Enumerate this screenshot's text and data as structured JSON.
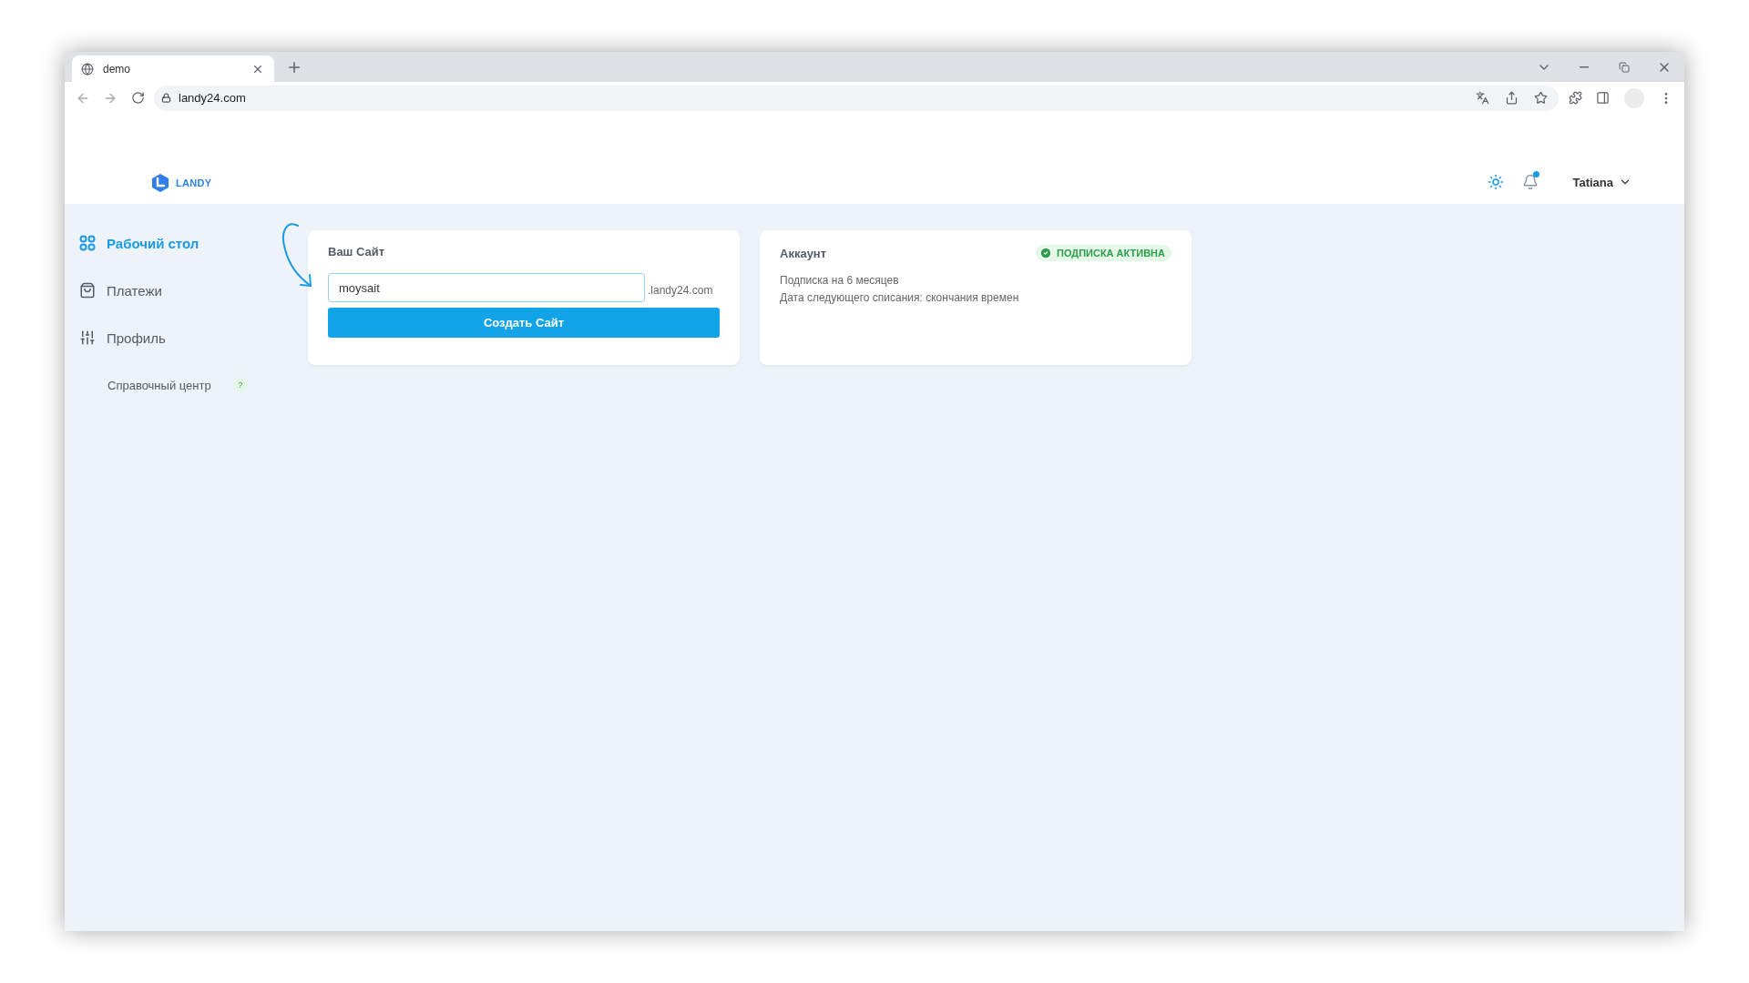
{
  "browser": {
    "tab": {
      "title": "demo"
    },
    "address": "landy24.com"
  },
  "app": {
    "logo": "LANDY",
    "user": "Tatiana",
    "notifications": {
      "unread": true
    }
  },
  "sidebar": {
    "items": [
      {
        "label": "Рабочий стол",
        "selected": true
      },
      {
        "label": "Платежи",
        "selected": false
      },
      {
        "label": "Профиль",
        "selected": false
      }
    ],
    "help": {
      "label": "Справочный центр",
      "badge": "?"
    }
  },
  "site_card": {
    "title": "Ваш Сайт",
    "input": {
      "value": "moysait"
    },
    "domain_suffix": ".landy24.com",
    "button": "Создать Сайт"
  },
  "account_card": {
    "title": "Аккаунт",
    "status": {
      "label": "ПОДПИСКА АКТИВНА",
      "active": true
    },
    "lines": [
      "Подписка на 6 месяцев",
      "Дата следующего списания: скончания времен"
    ]
  }
}
